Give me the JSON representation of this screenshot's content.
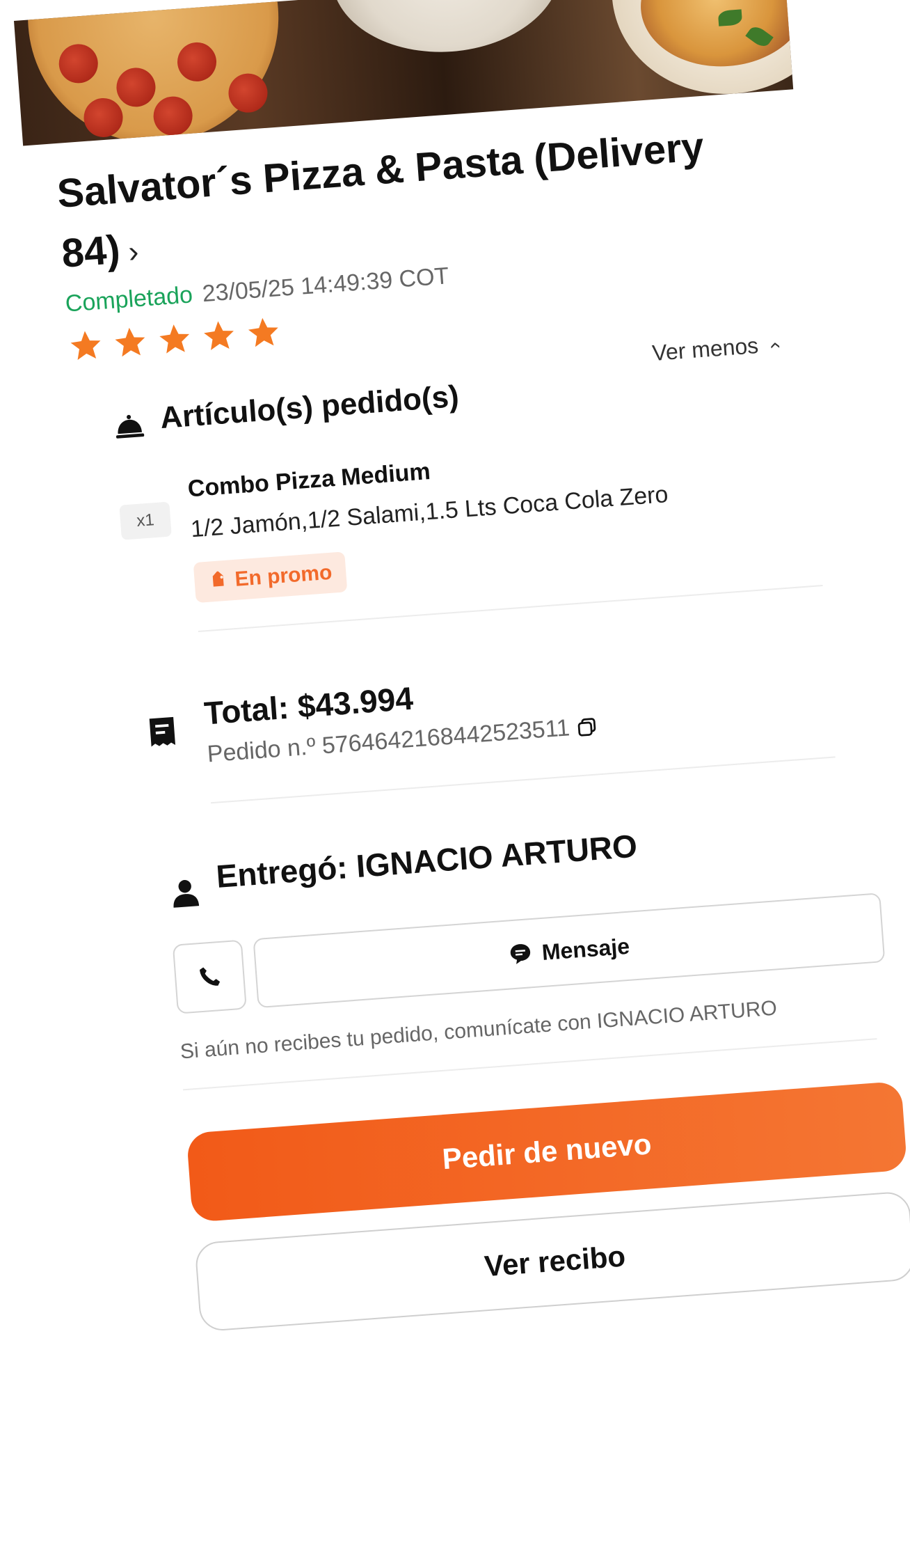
{
  "restaurant": {
    "name": "Salvator´s Pizza & Pasta (Delivery 84)",
    "chevron": "›"
  },
  "order": {
    "status": "Completado",
    "datetime": "23/05/25 14:49:39 COT",
    "rating": 5,
    "rating_max": 5
  },
  "items_section": {
    "title": "Artículo(s) pedido(s)",
    "toggle_label": "Ver menos",
    "items": [
      {
        "quantity": "x1",
        "name": "Combo Pizza Medium",
        "description": "1/2 Jamón,1/2 Salami,1.5 Lts Coca Cola Zero",
        "badge": "En promo"
      }
    ]
  },
  "total_section": {
    "total": "Total: $43.994",
    "order_number": "Pedido n.º 5764642168442523511"
  },
  "courier_section": {
    "title": "Entregó: IGNACIO ARTURO",
    "message_label": "Mensaje",
    "hint": "Si aún no recibes tu pedido, comunícate con IGNACIO ARTURO"
  },
  "actions": {
    "reorder_label": "Pedir de nuevo",
    "receipt_label": "Ver recibo"
  },
  "colors": {
    "accent": "#f25a18",
    "status_green": "#1aa35a",
    "star": "#f47a22",
    "promo_bg": "#fde9df"
  },
  "icons": {
    "items": "food-cloche-icon",
    "total": "receipt-icon",
    "copy": "copy-icon",
    "courier": "person-icon",
    "call": "phone-icon",
    "message": "chat-bubble-icon",
    "promo": "tag-icon",
    "toggle": "chevron-up-icon"
  }
}
